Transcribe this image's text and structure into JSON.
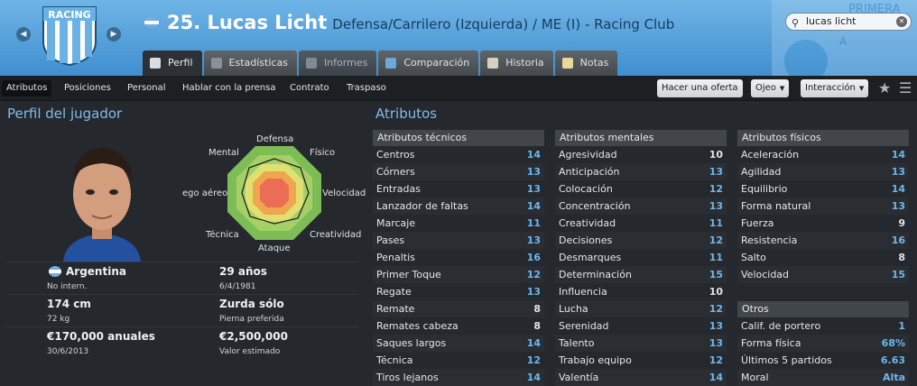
{
  "header": {
    "club_crest_text": "RACING",
    "player_number_name": "25. Lucas Licht",
    "subtitle": "Defensa/Carrilero (Izquierda) / ME (I) - Racing Club",
    "search_value": "lucas licht",
    "league_logo_text": "PRIMERA",
    "league_logo_letter": "A"
  },
  "tabs": [
    {
      "label": "Perfil"
    },
    {
      "label": "Estadísticas"
    },
    {
      "label": "Informes"
    },
    {
      "label": "Comparación"
    },
    {
      "label": "Historia"
    },
    {
      "label": "Notas"
    }
  ],
  "subnav": [
    "Atributos",
    "Posiciones",
    "Personal",
    "Hablar con la prensa",
    "Contrato",
    "Traspaso"
  ],
  "actions": {
    "offer": "Hacer una oferta",
    "eye": "Ojeo",
    "interaction": "Interacción"
  },
  "profile": {
    "heading": "Perfil del jugador",
    "radar_labels": {
      "top": "Defensa",
      "top_left": "Mental",
      "top_right": "Físico",
      "left": "ego aéreo",
      "right": "Velocidad",
      "bottom_left": "Técnica",
      "bottom_right": "Creatividad",
      "bottom": "Ataque"
    },
    "nation": "Argentina",
    "caps": "No intern.",
    "age": "29 años",
    "dob": "6/4/1981",
    "height": "174 cm",
    "weight": "72 kg",
    "foot": "Zurda sólo",
    "foot_label": "Pierna preferida",
    "wage": "€170,000 anuales",
    "contract_end": "30/6/2013",
    "value": "€2,500,000",
    "value_label": "Valor estimado"
  },
  "attributes": {
    "heading": "Atributos",
    "technical": {
      "title": "Atributos técnicos",
      "rows": [
        {
          "name": "Centros",
          "value": "14"
        },
        {
          "name": "Córners",
          "value": "13"
        },
        {
          "name": "Entradas",
          "value": "13"
        },
        {
          "name": "Lanzador de faltas",
          "value": "14"
        },
        {
          "name": "Marcaje",
          "value": "11"
        },
        {
          "name": "Pases",
          "value": "13"
        },
        {
          "name": "Penaltis",
          "value": "16"
        },
        {
          "name": "Primer Toque",
          "value": "12"
        },
        {
          "name": "Regate",
          "value": "13"
        },
        {
          "name": "Remate",
          "value": "8"
        },
        {
          "name": "Remates cabeza",
          "value": "8"
        },
        {
          "name": "Saques largos",
          "value": "14"
        },
        {
          "name": "Técnica",
          "value": "12"
        },
        {
          "name": "Tiros lejanos",
          "value": "14"
        }
      ]
    },
    "mental": {
      "title": "Atributos mentales",
      "rows": [
        {
          "name": "Agresividad",
          "value": "10"
        },
        {
          "name": "Anticipación",
          "value": "13"
        },
        {
          "name": "Colocación",
          "value": "12"
        },
        {
          "name": "Concentración",
          "value": "13"
        },
        {
          "name": "Creatividad",
          "value": "11"
        },
        {
          "name": "Decisiones",
          "value": "12"
        },
        {
          "name": "Desmarques",
          "value": "11"
        },
        {
          "name": "Determinación",
          "value": "15"
        },
        {
          "name": "Influencia",
          "value": "10"
        },
        {
          "name": "Lucha",
          "value": "12"
        },
        {
          "name": "Serenidad",
          "value": "13"
        },
        {
          "name": "Talento",
          "value": "13"
        },
        {
          "name": "Trabajo equipo",
          "value": "12"
        },
        {
          "name": "Valentía",
          "value": "14"
        }
      ]
    },
    "physical": {
      "title": "Atributos físicos",
      "rows": [
        {
          "name": "Aceleración",
          "value": "14"
        },
        {
          "name": "Agilidad",
          "value": "13"
        },
        {
          "name": "Equilibrio",
          "value": "14"
        },
        {
          "name": "Forma natural",
          "value": "13"
        },
        {
          "name": "Fuerza",
          "value": "9"
        },
        {
          "name": "Resistencia",
          "value": "16"
        },
        {
          "name": "Salto",
          "value": "8"
        },
        {
          "name": "Velocidad",
          "value": "15"
        }
      ]
    },
    "others": {
      "title": "Otros",
      "rows": [
        {
          "name": "Calif. de portero",
          "value": "1"
        },
        {
          "name": "Forma física",
          "value": "68%"
        },
        {
          "name": "Últimos 5 partidos",
          "value": "6.63"
        },
        {
          "name": "Moral",
          "value": "Alta"
        }
      ]
    }
  },
  "colors": {
    "header_blue": "#4f9fd9",
    "accent": "#7dbdf0",
    "high_value": "#6db6ee"
  }
}
